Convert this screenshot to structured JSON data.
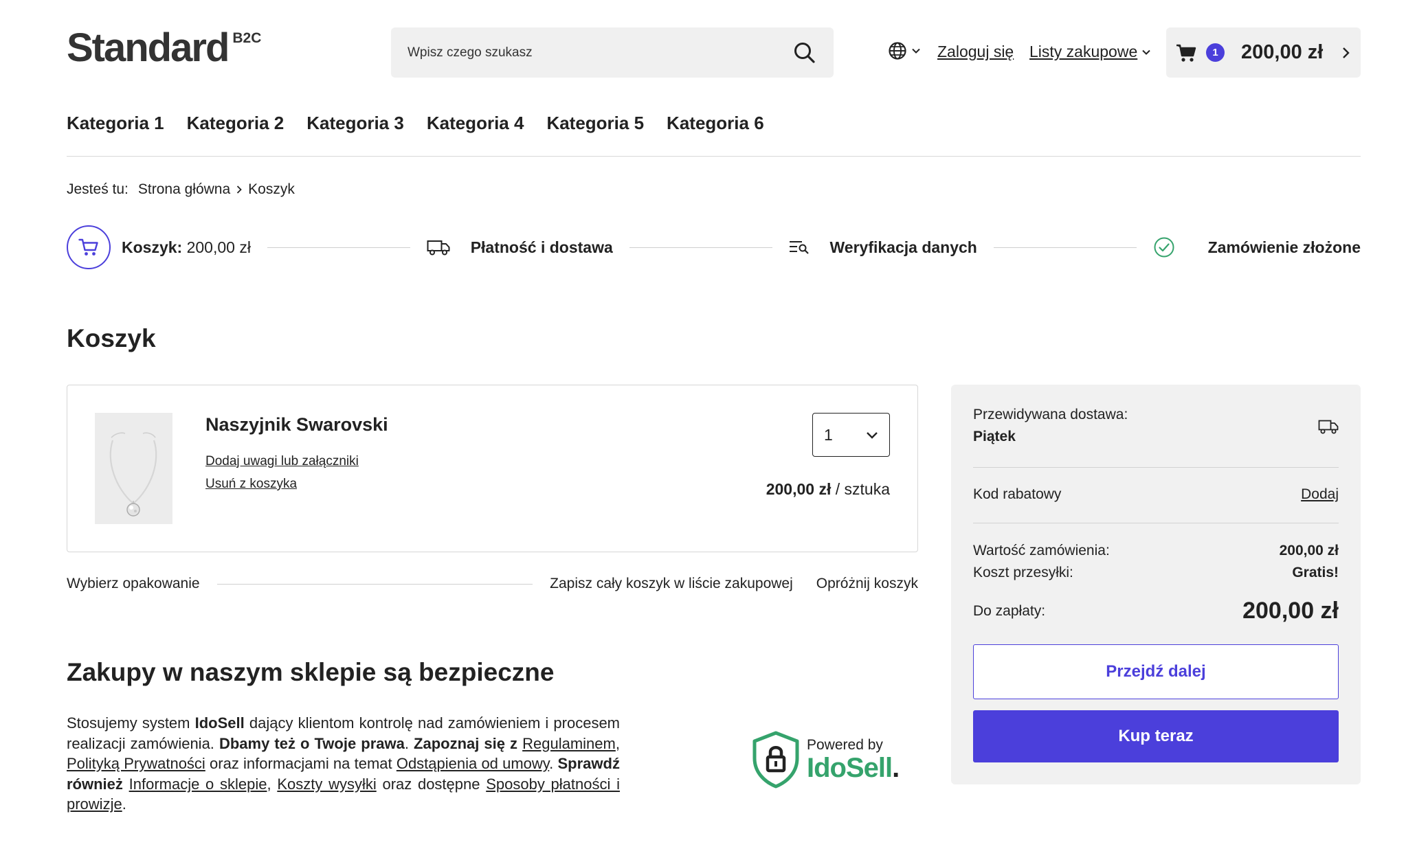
{
  "header": {
    "logo_text": "Standard",
    "logo_sup": "B2C",
    "search_placeholder": "Wpisz czego szukasz",
    "login": "Zaloguj się",
    "shopping_lists": "Listy zakupowe",
    "cart_count": "1",
    "cart_total": "200,00 zł"
  },
  "nav": [
    "Kategoria 1",
    "Kategoria 2",
    "Kategoria 3",
    "Kategoria 4",
    "Kategoria 5",
    "Kategoria 6"
  ],
  "breadcrumb": {
    "label": "Jesteś tu:",
    "home": "Strona główna",
    "current": "Koszyk"
  },
  "steps": {
    "cart_label": "Koszyk:",
    "cart_value": "200,00 zł",
    "payment": "Płatność i dostawa",
    "verify": "Weryfikacja danych",
    "done": "Zamówienie złożone"
  },
  "page_title": "Koszyk",
  "product": {
    "name": "Naszyjnik Swarovski",
    "add_notes": "Dodaj uwagi lub załączniki",
    "remove": "Usuń z koszyka",
    "quantity": "1",
    "price": "200,00 zł",
    "unit": "/ sztuka"
  },
  "cart_actions": {
    "packaging": "Wybierz opakowanie",
    "save_list": "Zapisz cały koszyk w liście zakupowej",
    "empty": "Opróżnij koszyk"
  },
  "safety": {
    "title": "Zakupy w naszym sklepie są bezpieczne",
    "p1": "Stosujemy system",
    "idosell": "IdoSell",
    "p2": "dający klientom kontrolę nad zamówieniem i procesem realizacji zamówienia.",
    "b1": "Dbamy też o Twoje prawa",
    "p3": ".",
    "b2": "Zapoznaj się z",
    "l1": "Regulaminem",
    "p4": ",",
    "l2": "Polityką Prywatności",
    "p5": "oraz informacjami na temat",
    "l3": "Odstąpienia od umowy",
    "p6": ".",
    "b3": "Sprawdź również",
    "l4": "Informacje o sklepie",
    "p7": ",",
    "l5": "Koszty wysyłki",
    "p8": "oraz dostępne",
    "l6": "Sposoby płatności i prowizje",
    "p9": ".",
    "powered_by": "Powered by",
    "brand_ido": "IdoSell",
    "brand_dot": "."
  },
  "summary": {
    "delivery_label": "Przewidywana dostawa:",
    "delivery_day": "Piątek",
    "discount_label": "Kod rabatowy",
    "discount_action": "Dodaj",
    "order_value_label": "Wartość zamówienia:",
    "order_value": "200,00 zł",
    "shipping_label": "Koszt przesyłki:",
    "shipping_value": "Gratis!",
    "to_pay_label": "Do zapłaty:",
    "to_pay_value": "200,00 zł",
    "continue": "Przejdź dalej",
    "buy_now": "Kup teraz"
  },
  "colors": {
    "accent": "#4b3fdb",
    "success": "#35a36c",
    "panel": "#f1f1f1"
  }
}
